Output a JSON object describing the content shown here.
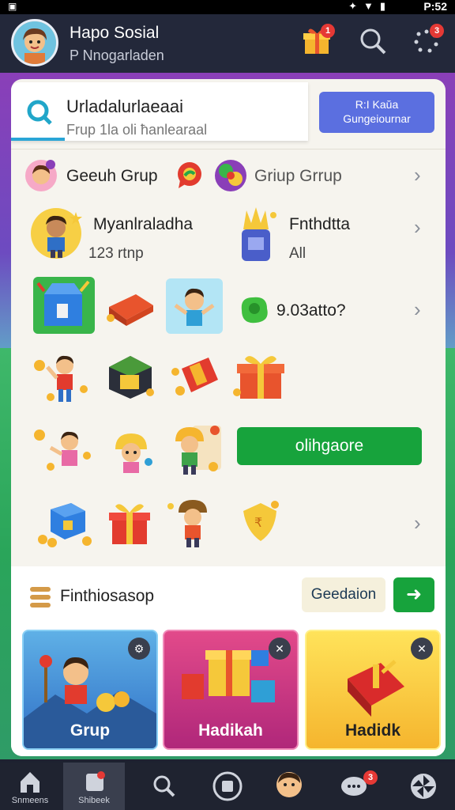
{
  "status": {
    "time": "P:52"
  },
  "header": {
    "title": "Hapo Sosial",
    "subtitle": "P Nnogarladen",
    "gift_badge": "1",
    "menu_badge": "3"
  },
  "search": {
    "query": "Urladalurlaeaai",
    "placeholder": "Frup   1la oli ħanlearaal",
    "cta_line1": "R:I Kaŭa",
    "cta_line2": "Gungeiournar"
  },
  "groups": {
    "label": "Geeuh Grup",
    "right_label": "Griup Grrup"
  },
  "featured": {
    "left_title": "Myanlraladha",
    "left_sub": "123 rtnp",
    "right_title": "Fnthdtta",
    "right_sub": "All"
  },
  "row3": {
    "label": "9.03atto?"
  },
  "green_button": {
    "label": "olihgaore"
  },
  "section": {
    "title": "Finthiosasop",
    "pill": "Geedaion"
  },
  "promos": [
    {
      "label": "Grup",
      "color": "#fff"
    },
    {
      "label": "Hadikah",
      "color": "#fff"
    },
    {
      "label": "Hadidk",
      "color": "#222"
    }
  ],
  "nav": {
    "home": "Snmeens",
    "selected": "Shibeek"
  },
  "nav_badge": "3",
  "colors": {
    "accent_green": "#17a33c",
    "cta_blue": "#5b6fe0",
    "badge_red": "#e53935"
  }
}
